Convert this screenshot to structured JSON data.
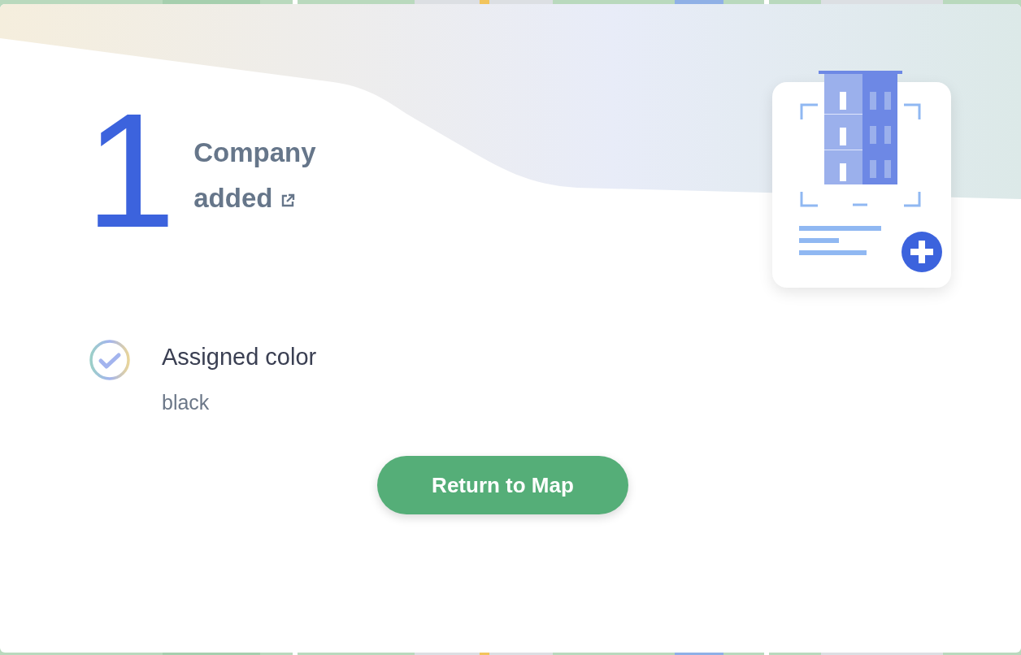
{
  "summary": {
    "count": "1",
    "label_line_1": "Company",
    "label_line_2": "added"
  },
  "result": {
    "title": "Assigned color",
    "value": "black"
  },
  "button": {
    "label": "Return to Map"
  }
}
